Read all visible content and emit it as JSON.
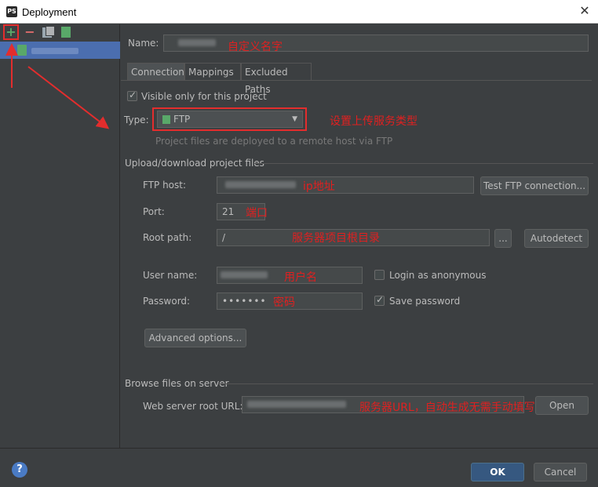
{
  "window": {
    "title": "Deployment",
    "close_glyph": "✕",
    "app_icon_text": "PS"
  },
  "left": {
    "toolbar": {
      "add": "+",
      "remove": "−"
    }
  },
  "main": {
    "name_label": "Name:",
    "tabs": [
      "Connection",
      "Mappings",
      "Excluded Paths"
    ],
    "visible_only_label": "Visible only for this project",
    "type_label": "Type:",
    "type_value": "FTP",
    "type_note": "Project files are deployed to a remote host via FTP",
    "upload_section": "Upload/download project files",
    "ftp_host_label": "FTP host:",
    "test_button": "Test FTP connection...",
    "port_label": "Port:",
    "port_value": "21",
    "root_path_label": "Root path:",
    "root_path_value": "/",
    "browse_button": "...",
    "autodetect_button": "Autodetect",
    "user_name_label": "User name:",
    "anonymous_label": "Login as anonymous",
    "password_label": "Password:",
    "password_value": "•••••••",
    "save_password_label": "Save password",
    "advanced_button": "Advanced options...",
    "browse_section": "Browse files on server",
    "web_root_label": "Web server root URL:",
    "open_button": "Open"
  },
  "annotations": {
    "name": "自定义名字",
    "type": "设置上传服务类型",
    "host": "ip地址",
    "port": "端口",
    "root": "服务器项目根目录",
    "user": "用户名",
    "password": "密码",
    "url": "服务器URL，自动生成无需手动填写"
  },
  "footer": {
    "help": "?",
    "ok": "OK",
    "cancel": "Cancel"
  }
}
